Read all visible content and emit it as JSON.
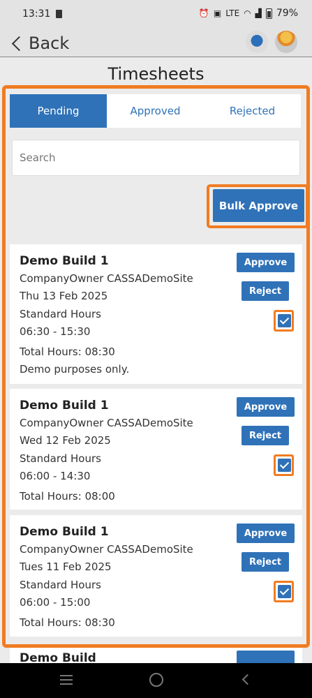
{
  "status_bar": {
    "time": "13:31",
    "battery": "79%",
    "network_label": "LTE"
  },
  "header": {
    "back_label": "Back"
  },
  "page": {
    "title": "Timesheets"
  },
  "tabs": [
    {
      "label": "Pending",
      "active": true
    },
    {
      "label": "Approved",
      "active": false
    },
    {
      "label": "Rejected",
      "active": false
    }
  ],
  "search": {
    "placeholder": "Search",
    "value": ""
  },
  "bulk_approve_label": "Bulk Approve",
  "cards": [
    {
      "title": "Demo Build 1",
      "company": "CompanyOwner CASSADemoSite",
      "date": "Thu 13 Feb 2025",
      "hours_type": "Standard Hours",
      "time_range": "06:30 - 15:30",
      "total_hours": "Total Hours: 08:30",
      "note": "Demo purposes only.",
      "approve_label": "Approve",
      "reject_label": "Reject",
      "checked": true
    },
    {
      "title": "Demo Build 1",
      "company": "CompanyOwner CASSADemoSite",
      "date": "Wed 12 Feb 2025",
      "hours_type": "Standard Hours",
      "time_range": "06:00 - 14:30",
      "total_hours": "Total Hours: 08:00",
      "note": "",
      "approve_label": "Approve",
      "reject_label": "Reject",
      "checked": true
    },
    {
      "title": "Demo Build 1",
      "company": "CompanyOwner CASSADemoSite",
      "date": "Tues 11 Feb 2025",
      "hours_type": "Standard Hours",
      "time_range": "06:00 - 15:00",
      "total_hours": "Total Hours: 08:30",
      "note": "",
      "approve_label": "Approve",
      "reject_label": "Reject",
      "checked": true
    }
  ],
  "partial_card": {
    "title": "Demo Build"
  },
  "colors": {
    "primary": "#2f72b8",
    "highlight": "#f07c22",
    "background": "#ebebeb"
  }
}
